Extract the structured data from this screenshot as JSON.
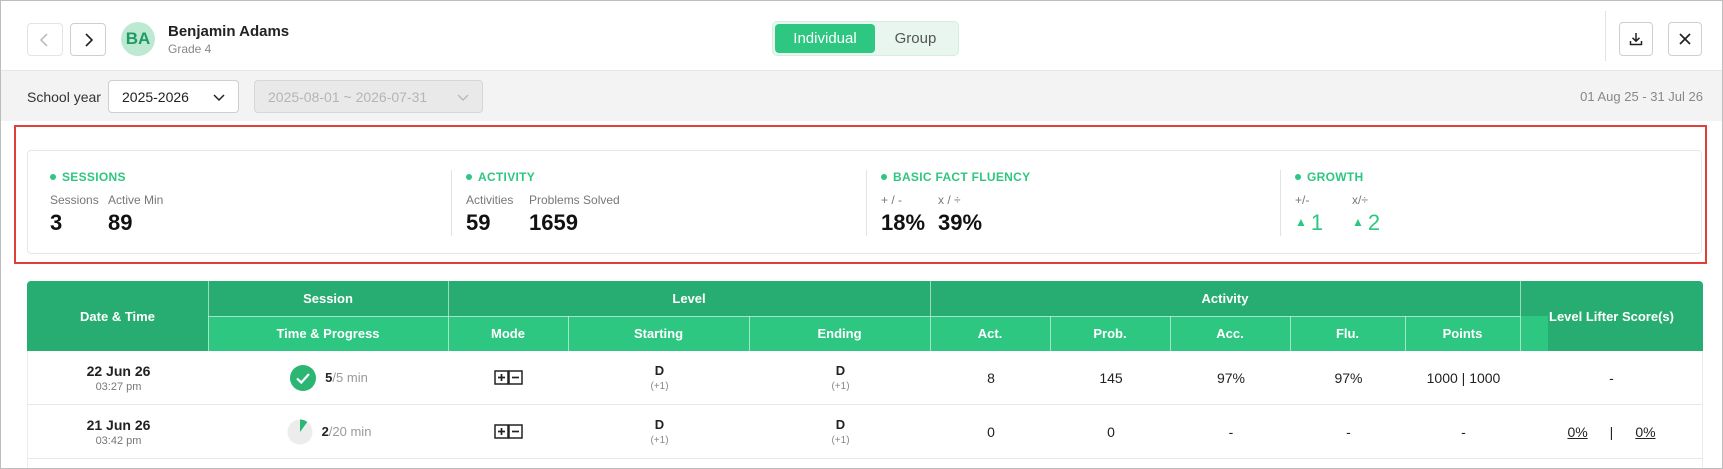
{
  "header": {
    "prev_icon": "chevron-left-icon",
    "next_icon": "chevron-right-icon",
    "avatar_initials": "BA",
    "student_name": "Benjamin Adams",
    "student_grade": "Grade 4",
    "view_toggle": {
      "individual": "Individual",
      "group": "Group",
      "selected": "Individual"
    },
    "download_icon": "download-icon",
    "close_icon": "close-icon",
    "accent_color": "#2ec781"
  },
  "filters": {
    "school_year_label": "School year",
    "school_year_value": "2025-2026",
    "date_range_value": "2025-08-01 ~ 2026-07-31",
    "date_range_summary": "01 Aug 25 - 31 Jul 26"
  },
  "summary": {
    "sessions": {
      "title": "SESSIONS",
      "labels": [
        "Sessions",
        "Active Min"
      ],
      "values": [
        "3",
        "89"
      ]
    },
    "activity": {
      "title": "ACTIVITY",
      "labels": [
        "Activities",
        "Problems Solved"
      ],
      "values": [
        "59",
        "1659"
      ]
    },
    "fluency": {
      "title": "BASIC FACT FLUENCY",
      "labels": [
        "+ / -",
        "x / ÷"
      ],
      "values": [
        "18%",
        "39%"
      ]
    },
    "growth": {
      "title": "GROWTH",
      "labels": [
        "+/-",
        "x/÷"
      ],
      "values": [
        "1",
        "2"
      ],
      "trend_icon": "triangle-up-icon"
    }
  },
  "table": {
    "group_headers": {
      "date_time": "Date & Time",
      "session": "Session",
      "level": "Level",
      "activity": "Activity",
      "level_lifter": "Level Lifter Score(s)"
    },
    "sub_headers": {
      "time_progress": "Time & Progress",
      "mode": "Mode",
      "starting": "Starting",
      "ending": "Ending",
      "act": "Act.",
      "prob": "Prob.",
      "acc": "Acc.",
      "flu": "Flu.",
      "points": "Points"
    },
    "rows": [
      {
        "date": "22 Jun 26",
        "time": "03:27 pm",
        "progress_done": "5",
        "progress_total": "/5 min",
        "progress_fraction": 1.0,
        "progress_icon": "check-circle-icon",
        "mode_icon": "add-subtract-mode-icon",
        "starting": "D",
        "starting_sub": "(+1)",
        "ending": "D",
        "ending_sub": "(+1)",
        "act": "8",
        "prob": "145",
        "acc": "97%",
        "flu": "97%",
        "points": "1000 | 1000",
        "lifter": "-"
      },
      {
        "date": "21 Jun 26",
        "time": "03:42 pm",
        "progress_done": "2",
        "progress_total": "/20 min",
        "progress_fraction": 0.1,
        "progress_icon": "progress-pie-icon",
        "mode_icon": "add-subtract-mode-icon",
        "starting": "D",
        "starting_sub": "(+1)",
        "ending": "D",
        "ending_sub": "(+1)",
        "act": "0",
        "prob": "0",
        "acc": "-",
        "flu": "-",
        "points": "-",
        "lifter_a": "0%",
        "lifter_sep": "|",
        "lifter_b": "0%"
      }
    ]
  }
}
